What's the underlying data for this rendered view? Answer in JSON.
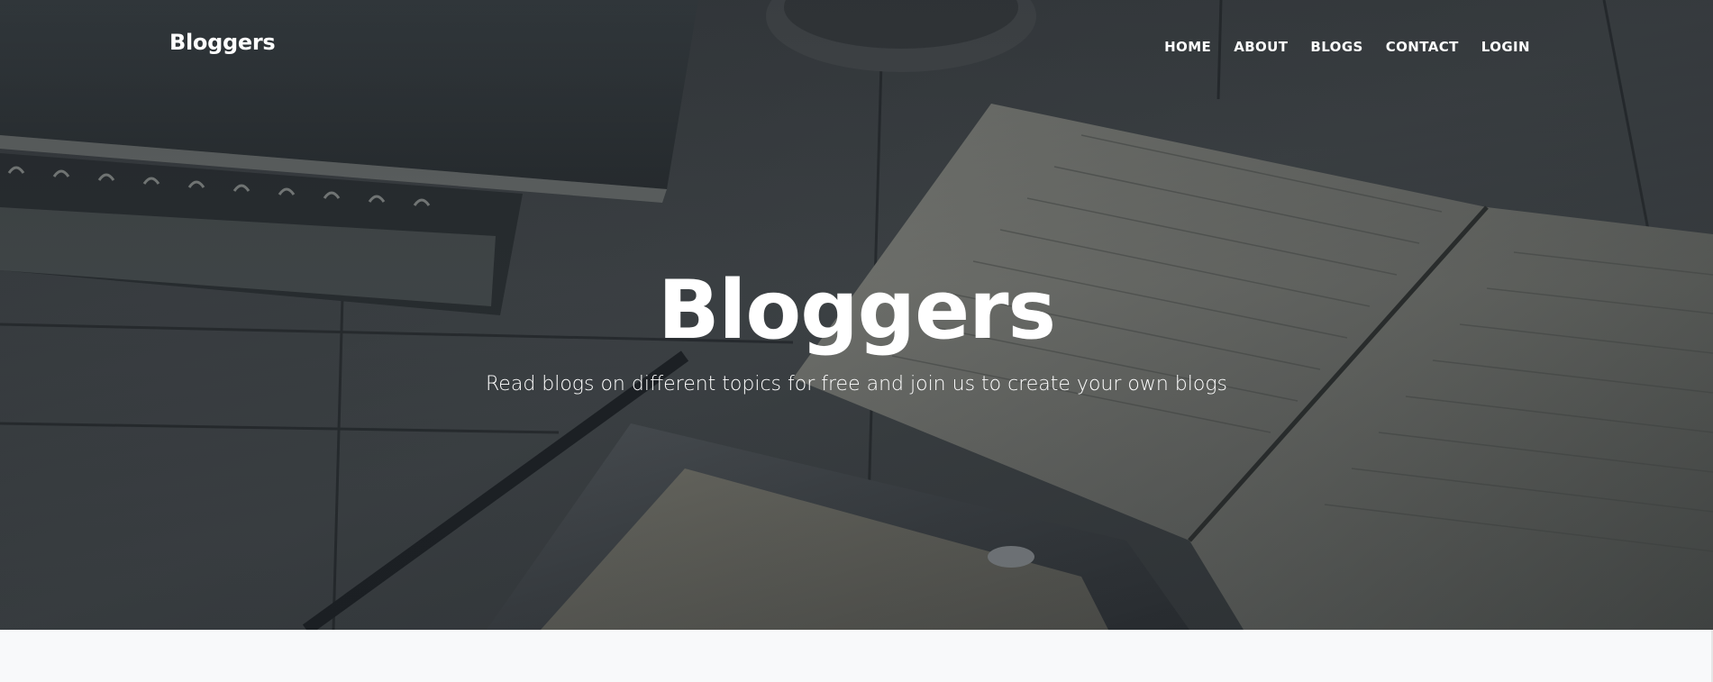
{
  "nav": {
    "brand": "Bloggers",
    "items": [
      {
        "label": "HOME"
      },
      {
        "label": "ABOUT"
      },
      {
        "label": "BLOGS"
      },
      {
        "label": "CONTACT"
      },
      {
        "label": "LOGIN"
      }
    ]
  },
  "hero": {
    "title": "Bloggers",
    "subtitle": "Read blogs on different topics for free and join us to create your own blogs"
  },
  "colors": {
    "nav_text": "#ffffff",
    "hero_text": "#ffffff",
    "content_background": "#f8f9fa"
  },
  "icons": {
    "hero_background": "desk-with-notebooks-tablet-photo"
  }
}
